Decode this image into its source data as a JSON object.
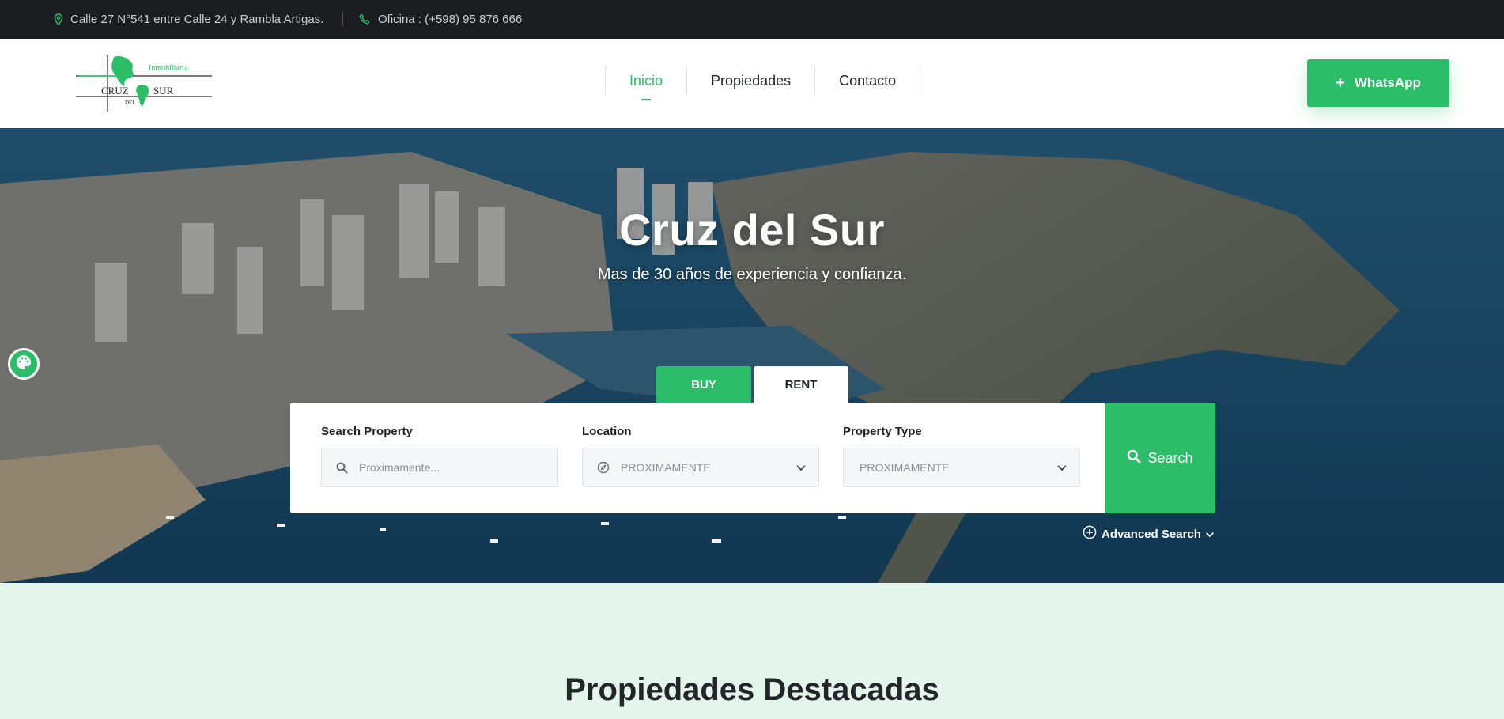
{
  "topbar": {
    "address": "Calle 27 N°541 entre Calle 24 y Rambla Artigas.",
    "phone": "Oficina : (+598) 95 876 666"
  },
  "header": {
    "logo_text": {
      "line1": "Inmobiliaria",
      "line2": "CRUZ",
      "line3": "DEL",
      "line4": "SUR"
    },
    "nav": [
      {
        "label": "Inicio",
        "active": true
      },
      {
        "label": "Propiedades",
        "active": false
      },
      {
        "label": "Contacto",
        "active": false
      }
    ],
    "whatsapp_label": "WhatsApp"
  },
  "hero": {
    "title": "Cruz del Sur",
    "subtitle": "Mas de 30 años de experiencia y confianza.",
    "tabs": [
      {
        "label": "BUY",
        "active": true
      },
      {
        "label": "RENT",
        "active": false
      }
    ],
    "search": {
      "property_label": "Search Property",
      "property_placeholder": "Proximamente...",
      "location_label": "Location",
      "location_value": "PROXIMAMENTE",
      "type_label": "Property Type",
      "type_value": "PROXIMAMENTE",
      "button_label": "Search"
    },
    "advanced_search": "Advanced Search"
  },
  "featured": {
    "title": "Propiedades Destacadas"
  },
  "colors": {
    "accent": "#2bbd68",
    "topbar_bg": "#1b1d21",
    "featured_bg": "#e4f6ec"
  }
}
